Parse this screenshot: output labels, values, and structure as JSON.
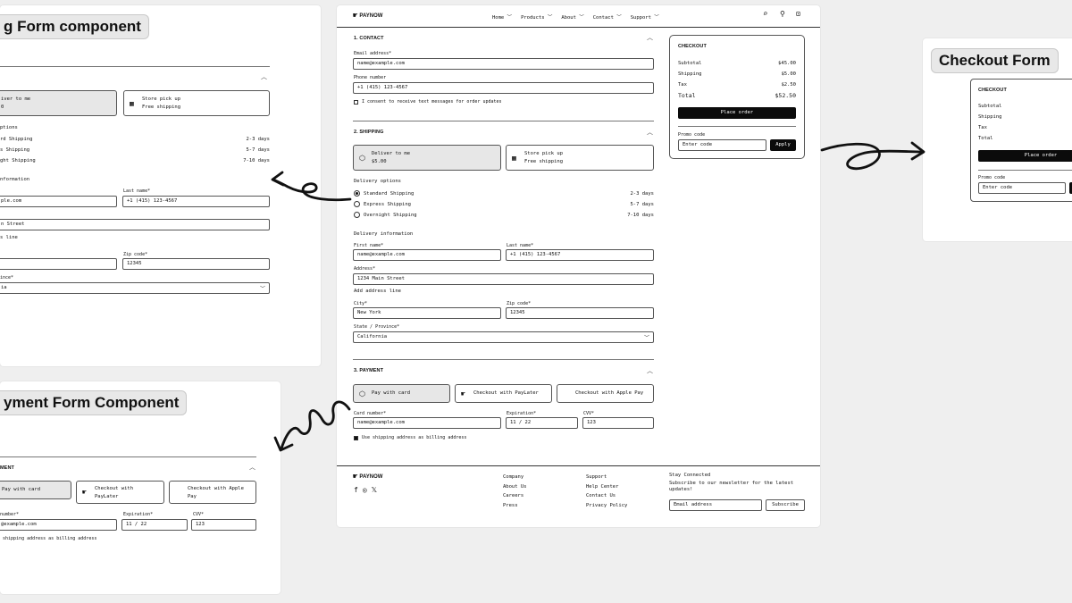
{
  "badges": {
    "shipping": "g Form component",
    "payment": "yment Form Component",
    "checkout": "Checkout Form"
  },
  "brand": "PAYNOW",
  "nav": [
    {
      "label": "Home",
      "chevron": true
    },
    {
      "label": "Products",
      "chevron": true
    },
    {
      "label": "About",
      "chevron": true
    },
    {
      "label": "Contact",
      "chevron": true
    },
    {
      "label": "Support",
      "chevron": true
    }
  ],
  "contact": {
    "title": "1. CONTACT",
    "email_label": "Email address*",
    "email_value": "name@example.com",
    "phone_label": "Phone number",
    "phone_value": "+1 (415) 123-4567",
    "consent": "I consent to receive text messages for order updates"
  },
  "shipping": {
    "title": "2. SHIPPING",
    "deliver_label": "Deliver to me",
    "deliver_price": "$5.00",
    "pickup_label": "Store pick up",
    "pickup_price": "Free shipping",
    "delivery_options_label": "Delivery options",
    "options": [
      {
        "name": "Standard Shipping",
        "time": "2-3 days",
        "selected": true
      },
      {
        "name": "Express Shipping",
        "time": "5-7 days",
        "selected": false
      },
      {
        "name": "Overnight Shipping",
        "time": "7-10 days",
        "selected": false
      }
    ],
    "info_label": "Delivery information",
    "first_name_label": "First name*",
    "first_name_value": "name@example.com",
    "last_name_label": "Last name*",
    "last_name_value": "+1 (415) 123-4567",
    "address_label": "Address*",
    "address_value": "1234 Main Street",
    "add_line": "Add address line",
    "city_label": "City*",
    "city_value": "New York",
    "zip_label": "Zip code*",
    "zip_value": "12345",
    "state_label": "State / Province*",
    "state_value": "California"
  },
  "payment": {
    "title": "3. PAYMENT",
    "card_label": "Pay with card",
    "paylater_label": "Checkout with PayLater",
    "applepay_label": "Checkout with Apple Pay",
    "card_number_label": "Card number*",
    "card_number_value": "name@example.com",
    "exp_label": "Expiration*",
    "exp_value": "11 / 22",
    "cvv_label": "CVV*",
    "cvv_value": "123",
    "billing_same": "Use shipping address as billing address"
  },
  "checkout": {
    "title": "CHECKOUT",
    "rows": [
      {
        "label": "Subtotal",
        "value": "$45.00"
      },
      {
        "label": "Shipping",
        "value": "$5.00"
      },
      {
        "label": "Tax",
        "value": "$2.50"
      },
      {
        "label": "Total",
        "value": "$52.50"
      }
    ],
    "place_order": "Place order",
    "promo_label": "Promo code",
    "promo_placeholder": "Enter code",
    "apply": "Apply"
  },
  "footer": {
    "col1": [
      "Company",
      "About Us",
      "Careers",
      "Press"
    ],
    "col2": [
      "Support",
      "Help Center",
      "Contact Us",
      "Privacy Policy"
    ],
    "stay_title": "Stay Connected",
    "stay_text": "Subscribe to our newsletter for the latest updates!",
    "email_placeholder": "Email address",
    "subscribe": "Subscribe"
  },
  "left_shipping": {
    "deliver_label": "iver to me",
    "deliver_price": "0",
    "pickup_label": "Store pick up",
    "pickup_price": "Free shipping",
    "options_label": "ptions",
    "options": [
      {
        "name": "rd Shipping",
        "time": "2-3 days"
      },
      {
        "name": "s Shipping",
        "time": "5-7 days"
      },
      {
        "name": "ght Shipping",
        "time": "7-10 days"
      }
    ],
    "info_label": "nformation",
    "first_value": "ple.com",
    "last_label": "Last name*",
    "last_value": "+1 (415) 123-4567",
    "address_value": "n Street",
    "add_line": "s line",
    "zip_label": "Zip code*",
    "zip_value": "12345",
    "state_label": "ince*",
    "state_value": "ia"
  },
  "left_payment": {
    "title": "MENT",
    "card_label": "Pay with card",
    "paylater_label": "Checkout with PayLater",
    "applepay_label": "Checkout with Apple Pay",
    "card_label_small": "number*",
    "card_value": "@example.com",
    "exp_label": "Expiration*",
    "exp_value": "11 / 22",
    "cvv_label": "CVV*",
    "cvv_value": "123",
    "billing": "shipping address as billing address"
  },
  "right_checkout": {
    "title": "CHECKOUT",
    "rows": [
      "Subtotal",
      "Shipping",
      "Tax",
      "Total"
    ],
    "place_order": "Place order",
    "promo_label": "Promo code",
    "promo_placeholder": "Enter code"
  }
}
